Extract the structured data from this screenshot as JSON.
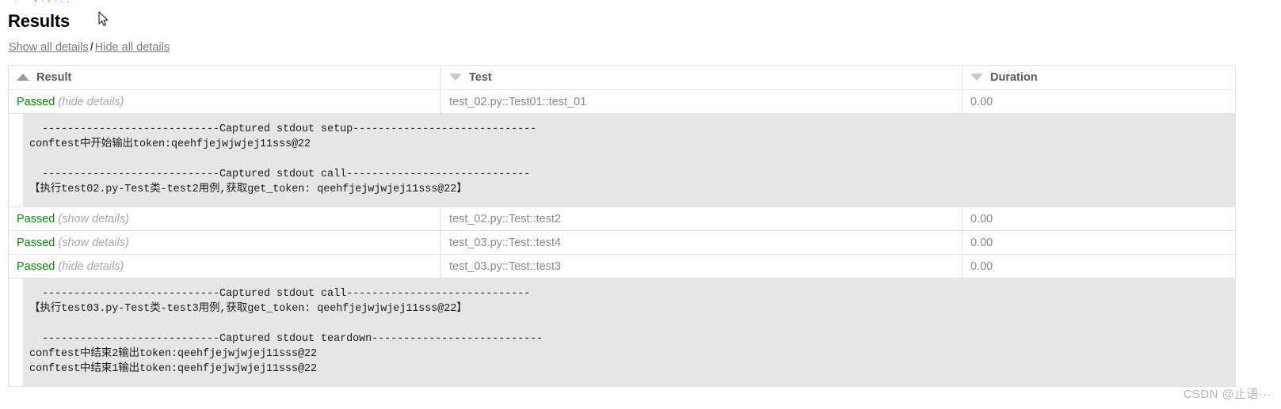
{
  "page": {
    "title": "Results",
    "watermark": "CSDN @止语···"
  },
  "top_sliver": {
    "fragments": [
      {
        "text": "p",
        "tone": "green"
      },
      {
        "text": "  :  ",
        "tone": "dim"
      },
      {
        "text": "t",
        "tone": "orange"
      },
      {
        "text": "p",
        "tone": "orange"
      },
      {
        "text": " , ",
        "tone": "dim"
      },
      {
        "text": "l",
        "tone": "dim"
      },
      {
        "text": "  ",
        "tone": "dim"
      },
      {
        "text": "i",
        "tone": "dim"
      },
      {
        "text": "   ",
        "tone": "dim"
      },
      {
        "text": "l",
        "tone": "orange"
      },
      {
        "text": "    ",
        "tone": "dim"
      },
      {
        "text": "i",
        "tone": "dim"
      },
      {
        "text": "   ",
        "tone": "dim"
      },
      {
        "text": "t",
        "tone": "red"
      },
      {
        "text": "  ",
        "tone": "dim"
      },
      {
        "text": "t",
        "tone": "red"
      }
    ]
  },
  "details_controls": {
    "show_all": "Show all details",
    "separator": "/",
    "hide_all": "Hide all details"
  },
  "table": {
    "columns": [
      {
        "key": "result",
        "label": "Result",
        "sort": "asc",
        "sort_icon": "triangle-up-icon"
      },
      {
        "key": "test",
        "label": "Test",
        "sort": "desc",
        "sort_icon": "triangle-down-icon"
      },
      {
        "key": "duration",
        "label": "Duration",
        "sort": "desc",
        "sort_icon": "triangle-down-icon"
      }
    ],
    "rows": [
      {
        "status": "Passed",
        "toggle": "(hide details)",
        "expanded": true,
        "test": "test_02.py::Test01::test_01",
        "duration": "0.00",
        "log": "  ----------------------------Captured stdout setup-----------------------------\nconftest中开始输出token:qeehfjejwjwjej11sss@22\n\n  ----------------------------Captured stdout call-----------------------------\n【执行test02.py-Test类-test2用例,获取get_token: qeehfjejwjwjej11sss@22】"
      },
      {
        "status": "Passed",
        "toggle": "(show details)",
        "expanded": false,
        "test": "test_02.py::Test::test2",
        "duration": "0.00",
        "log": ""
      },
      {
        "status": "Passed",
        "toggle": "(show details)",
        "expanded": false,
        "test": "test_03.py::Test::test4",
        "duration": "0.00",
        "log": ""
      },
      {
        "status": "Passed",
        "toggle": "(hide details)",
        "expanded": true,
        "test": "test_03.py::Test::test3",
        "duration": "0.00",
        "log": "  ----------------------------Captured stdout call-----------------------------\n【执行test03.py-Test类-test3用例,获取get_token: qeehfjejwjwjej11sss@22】\n\n  ----------------------------Captured stdout teardown---------------------------\nconftest中结束2输出token:qeehfjejwjwjej11sss@22\nconftest中结束1输出token:qeehfjejwjwjej11sss@22"
      }
    ]
  },
  "colors": {
    "passed": "#0a8a0a",
    "log_background": "#e6e6e6",
    "border": "#e3e3e3",
    "muted_text": "#8a8a8a"
  }
}
